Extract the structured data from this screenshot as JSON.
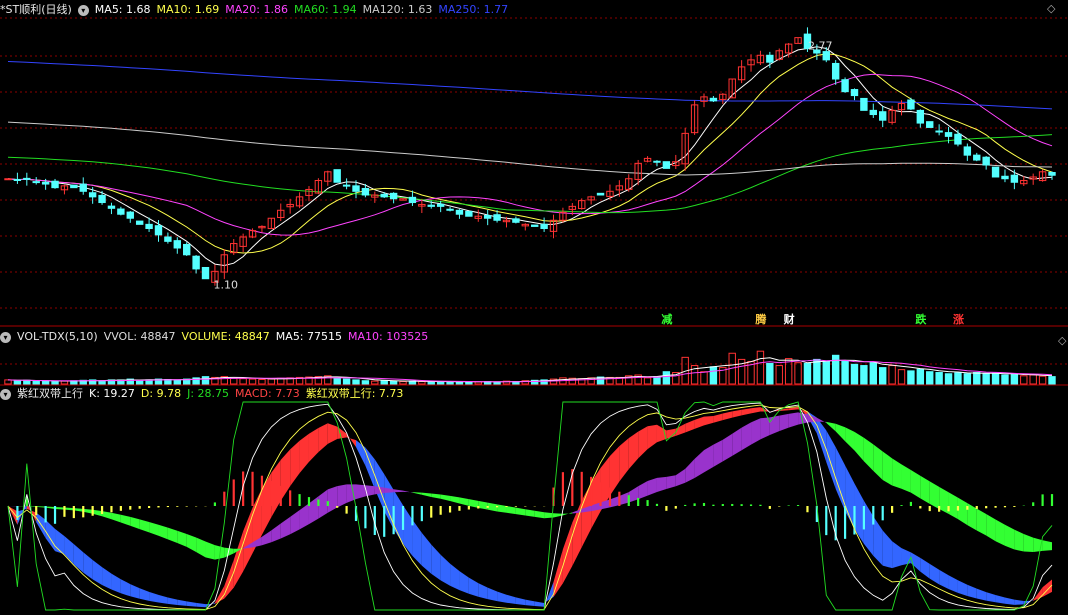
{
  "title": "*ST顺利(日线)",
  "price_header": {
    "items": [
      {
        "label": "MA5: 1.68",
        "color": "#ffffff"
      },
      {
        "label": "MA10: 1.69",
        "color": "#ffff4d"
      },
      {
        "label": "MA20: 1.86",
        "color": "#ff44ff"
      },
      {
        "label": "MA60: 1.94",
        "color": "#22dd22"
      },
      {
        "label": "MA120: 1.63",
        "color": "#cccccc"
      },
      {
        "label": "MA250: 1.77",
        "color": "#3344ff"
      }
    ]
  },
  "volume_header": {
    "title": "VOL-TDX(5,10)",
    "items": [
      {
        "label": "VVOL: 48847",
        "color": "#dddddd"
      },
      {
        "label": "VOLUME: 48847",
        "color": "#ffff4d"
      },
      {
        "label": "MA5: 77515",
        "color": "#ffffff"
      },
      {
        "label": "MA10: 103525",
        "color": "#ff44ff"
      }
    ]
  },
  "indicator_header": {
    "title": "紫红双带上行",
    "items": [
      {
        "label": "K: 19.27",
        "color": "#ffffff"
      },
      {
        "label": "D: 9.78",
        "color": "#ffff4d"
      },
      {
        "label": "J: 28.75",
        "color": "#22dd22"
      },
      {
        "label": "MACD: 7.73",
        "color": "#ff4444"
      },
      {
        "label": "紫红双带上行: 7.73",
        "color": "#ffff4d"
      }
    ]
  },
  "colors": {
    "up": "#ff3333",
    "down": "#54ffff",
    "grid": "#8b0000",
    "red_band": "#ff3333",
    "blue_band": "#3366ff",
    "purple_band": "#9933cc",
    "green_band": "#33ff33"
  },
  "chart_data": [
    {
      "type": "candlestick",
      "name": "price",
      "ylim": [
        1.0,
        2.85
      ],
      "y_log": true,
      "high_label": "2.77",
      "low_label": "1.10",
      "closes": [
        1.62,
        1.61,
        1.62,
        1.6,
        1.59,
        1.57,
        1.58,
        1.57,
        1.55,
        1.52,
        1.49,
        1.46,
        1.43,
        1.41,
        1.38,
        1.36,
        1.33,
        1.3,
        1.27,
        1.24,
        1.18,
        1.14,
        1.17,
        1.24,
        1.29,
        1.32,
        1.35,
        1.37,
        1.41,
        1.45,
        1.48,
        1.52,
        1.56,
        1.61,
        1.66,
        1.6,
        1.58,
        1.55,
        1.53,
        1.53,
        1.52,
        1.51,
        1.51,
        1.49,
        1.48,
        1.47,
        1.47,
        1.45,
        1.43,
        1.42,
        1.42,
        1.41,
        1.4,
        1.4,
        1.39,
        1.38,
        1.37,
        1.36,
        1.4,
        1.44,
        1.47,
        1.5,
        1.52,
        1.53,
        1.55,
        1.58,
        1.62,
        1.71,
        1.74,
        1.72,
        1.68,
        1.72,
        1.9,
        2.1,
        2.16,
        2.13,
        2.18,
        2.3,
        2.4,
        2.46,
        2.5,
        2.44,
        2.54,
        2.6,
        2.66,
        2.56,
        2.52,
        2.46,
        2.3,
        2.2,
        2.17,
        2.06,
        2.03,
        1.99,
        2.06,
        2.11,
        2.07,
        1.97,
        1.94,
        1.91,
        1.88,
        1.83,
        1.76,
        1.73,
        1.7,
        1.63,
        1.62,
        1.6,
        1.61,
        1.63,
        1.66,
        1.64
      ],
      "markers": [
        {
          "label": "减",
          "color": "#33ff33"
        },
        {
          "label": "腾",
          "color": "#ffcc44"
        },
        {
          "label": "财",
          "color": "#ffffff"
        },
        {
          "label": "跌",
          "color": "#33ff33"
        },
        {
          "label": "涨",
          "color": "#ff3333"
        }
      ],
      "series": [
        {
          "name": "MA5",
          "value": 1.68
        },
        {
          "name": "MA10",
          "value": 1.69
        },
        {
          "name": "MA20",
          "value": 1.86
        },
        {
          "name": "MA60",
          "value": 1.94
        },
        {
          "name": "MA120",
          "value": 1.63
        },
        {
          "name": "MA250",
          "value": 1.77
        }
      ]
    },
    {
      "type": "bar",
      "name": "volume",
      "values": [
        0.1,
        0.08,
        0.09,
        0.07,
        0.08,
        0.06,
        0.07,
        0.08,
        0.09,
        0.1,
        0.08,
        0.1,
        0.1,
        0.12,
        0.09,
        0.1,
        0.12,
        0.11,
        0.1,
        0.12,
        0.15,
        0.18,
        0.16,
        0.18,
        0.14,
        0.13,
        0.12,
        0.11,
        0.12,
        0.14,
        0.15,
        0.16,
        0.17,
        0.18,
        0.2,
        0.15,
        0.12,
        0.1,
        0.08,
        0.07,
        0.08,
        0.07,
        0.06,
        0.07,
        0.06,
        0.05,
        0.06,
        0.05,
        0.06,
        0.05,
        0.05,
        0.06,
        0.05,
        0.07,
        0.06,
        0.08,
        0.09,
        0.1,
        0.12,
        0.15,
        0.14,
        0.13,
        0.15,
        0.17,
        0.16,
        0.16,
        0.2,
        0.22,
        0.15,
        0.18,
        0.3,
        0.28,
        0.65,
        0.45,
        0.3,
        0.42,
        0.4,
        0.75,
        0.6,
        0.55,
        0.8,
        0.5,
        0.45,
        0.62,
        0.52,
        0.5,
        0.6,
        0.55,
        0.7,
        0.55,
        0.48,
        0.45,
        0.52,
        0.4,
        0.45,
        0.35,
        0.32,
        0.36,
        0.3,
        0.28,
        0.25,
        0.27,
        0.25,
        0.28,
        0.25,
        0.26,
        0.22,
        0.23,
        0.2,
        0.22,
        0.19,
        0.18
      ],
      "ylim": [
        0,
        1
      ]
    },
    {
      "type": "line",
      "name": "indicator",
      "series": [
        {
          "name": "K",
          "value": 19.27
        },
        {
          "name": "D",
          "value": 9.78
        },
        {
          "name": "J",
          "value": 28.75
        },
        {
          "name": "MACD",
          "value": 7.73
        }
      ]
    }
  ]
}
